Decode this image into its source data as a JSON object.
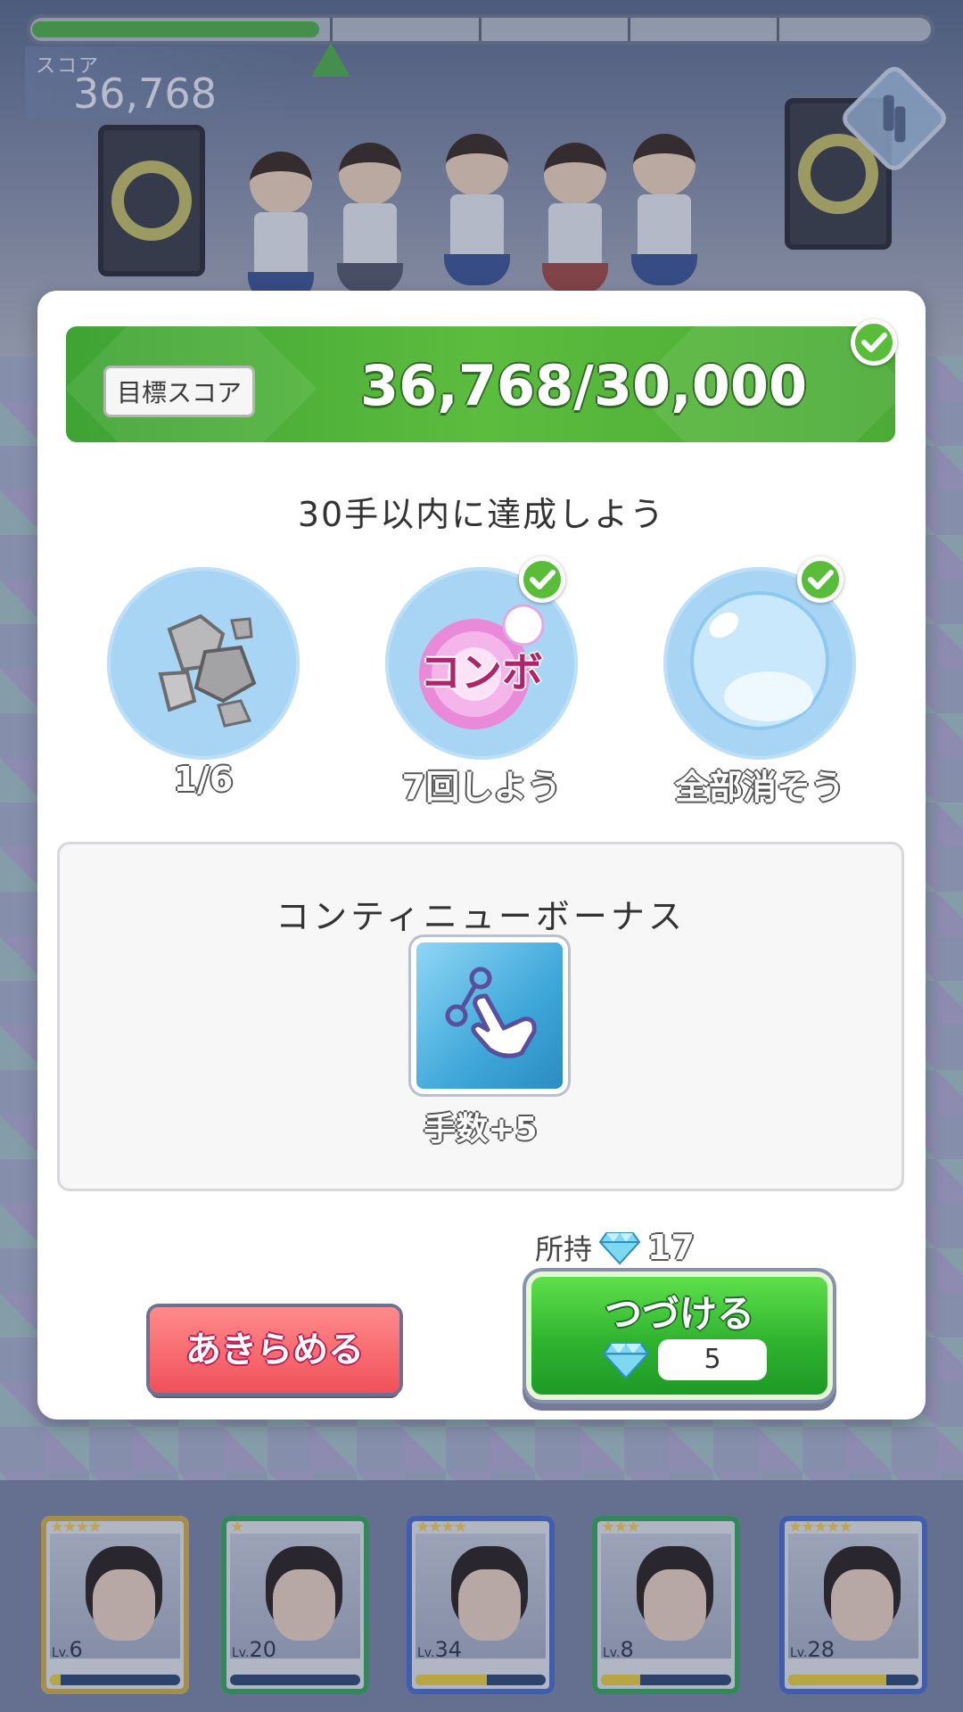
{
  "hud": {
    "score_label": "スコア",
    "score_value": "36,768",
    "progress_fraction": 0.32
  },
  "dialog": {
    "target_label": "目標スコア",
    "target_value": "36,768/30,000",
    "mission_title": "30手以内に達成しよう",
    "goals": [
      {
        "icon": "rock-icon",
        "caption": "1/6",
        "achieved": false
      },
      {
        "icon": "combo-icon",
        "badge_text": "コンボ",
        "caption": "7回しよう",
        "achieved": true
      },
      {
        "icon": "bubble-icon",
        "caption": "全部消そう",
        "achieved": true
      }
    ],
    "bonus_title": "コンティニューボーナス",
    "bonus_caption": "手数+5",
    "owned_label": "所持",
    "owned_count": "17",
    "giveup_label": "あきらめる",
    "continue_label": "つづける",
    "continue_cost": "5"
  },
  "cards": [
    {
      "stars": "★★★★",
      "level": "6",
      "frame": "#d4b24a",
      "exp": 0.08
    },
    {
      "stars": "★",
      "level": "20",
      "frame": "#3aa860",
      "exp": 0.0
    },
    {
      "stars": "★★★★",
      "level": "34",
      "frame": "#4a6fd0",
      "exp": 0.55
    },
    {
      "stars": "★★★",
      "level": "8",
      "frame": "#3aa860",
      "exp": 0.3
    },
    {
      "stars": "★★★★★",
      "level": "28",
      "frame": "#4a6fd0",
      "exp": 0.75
    }
  ],
  "colors": {
    "accent_green": "#4fb34a",
    "check_green": "#59bd3a",
    "giveup_red": "#f0505a"
  }
}
